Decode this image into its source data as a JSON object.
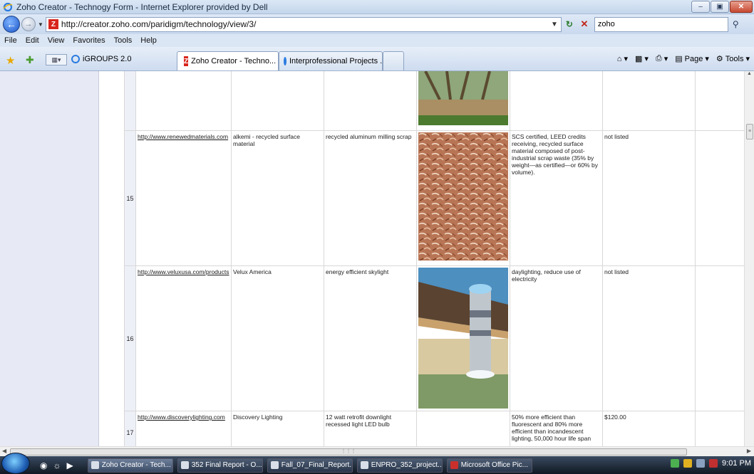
{
  "window": {
    "title": "Zoho Creator - Technogy Form - Internet Explorer provided by Dell"
  },
  "address_bar": {
    "url": "http://creator.zoho.com/paridigm/technology/view/3/",
    "search_value": "zoho"
  },
  "menu": [
    "File",
    "Edit",
    "View",
    "Favorites",
    "Tools",
    "Help"
  ],
  "favorites_bar": {
    "link": "iGROUPS 2.0"
  },
  "tabs": [
    {
      "label": "Zoho Creator - Techno..."
    },
    {
      "label": "Interprofessional Projects ..."
    }
  ],
  "command_bar": {
    "page": "Page",
    "tools": "Tools"
  },
  "rows": [
    {
      "num": "15",
      "url": "http://www.renewedmaterials.com",
      "name": "alkemi - recycled surface material",
      "type": "recycled aluminum milling scrap",
      "desc": "SCS certified, LEED credits receiving, recycled surface material composed of post-industrial scrap waste (35% by weight—as certified—or 60% by volume).",
      "price": "not listed"
    },
    {
      "num": "16",
      "url": "http://www.veluxusa.com/products",
      "name": "Velux America",
      "type": "energy efficient skylight",
      "desc": "daylighting, reduce use of electricity",
      "price": "not listed"
    },
    {
      "num": "17",
      "url": "http://www.discoverylighting.com",
      "name": "Discovery Lighting",
      "type": "12 watt retrofit downlight recessed light LED bulb",
      "desc": "50% more efficient than fluorescent and 80% more efficient than incandescent lighting, 50,000 hour life span",
      "price": "$120.00"
    }
  ],
  "taskbar": {
    "items": [
      "Zoho Creator - Tech...",
      "352 Final Report - O...",
      "Fall_07_Final_Report...",
      "ENPRO_352_project...",
      "Microsoft Office Pic..."
    ],
    "clock": "9:01 PM"
  }
}
